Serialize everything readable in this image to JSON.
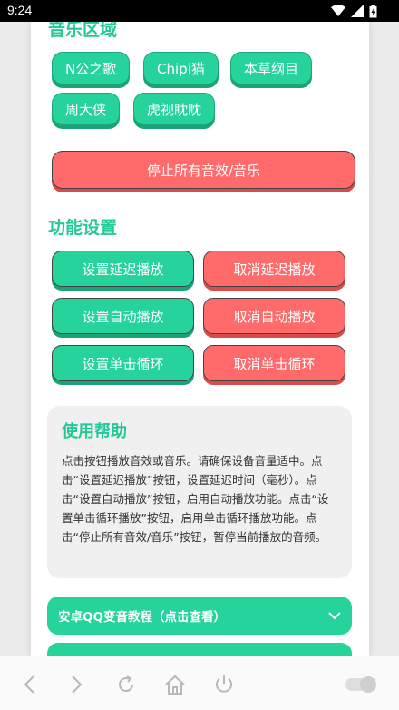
{
  "status": {
    "time": "9:24"
  },
  "music": {
    "title": "音乐区域",
    "chips": [
      "N公之歌",
      "Chipi猫",
      "本草纲目",
      "周大侠",
      "虎视眈眈"
    ],
    "stop_label": "停止所有音效/音乐"
  },
  "functions": {
    "title": "功能设置",
    "buttons": [
      {
        "set": "设置延迟播放",
        "cancel": "取消延迟播放"
      },
      {
        "set": "设置自动播放",
        "cancel": "取消自动播放"
      },
      {
        "set": "设置单击循环",
        "cancel": "取消单击循环"
      }
    ]
  },
  "help": {
    "title": "使用帮助",
    "text": "点击按钮播放音效或音乐。请确保设备音量适中。点击“设置延迟播放”按钮，设置延迟时间（毫秒）。点击“设置自动播放”按钮，启用自动播放功能。点击“设置单击循环播放”按钮，启用单击循环播放功能。点击“停止所有音效/音乐”按钮，暂停当前播放的音频。"
  },
  "accordions": [
    {
      "label": "安卓QQ变音教程（点击查看）"
    }
  ],
  "colors": {
    "accent": "#26d39b",
    "danger": "#ff6b6b"
  }
}
